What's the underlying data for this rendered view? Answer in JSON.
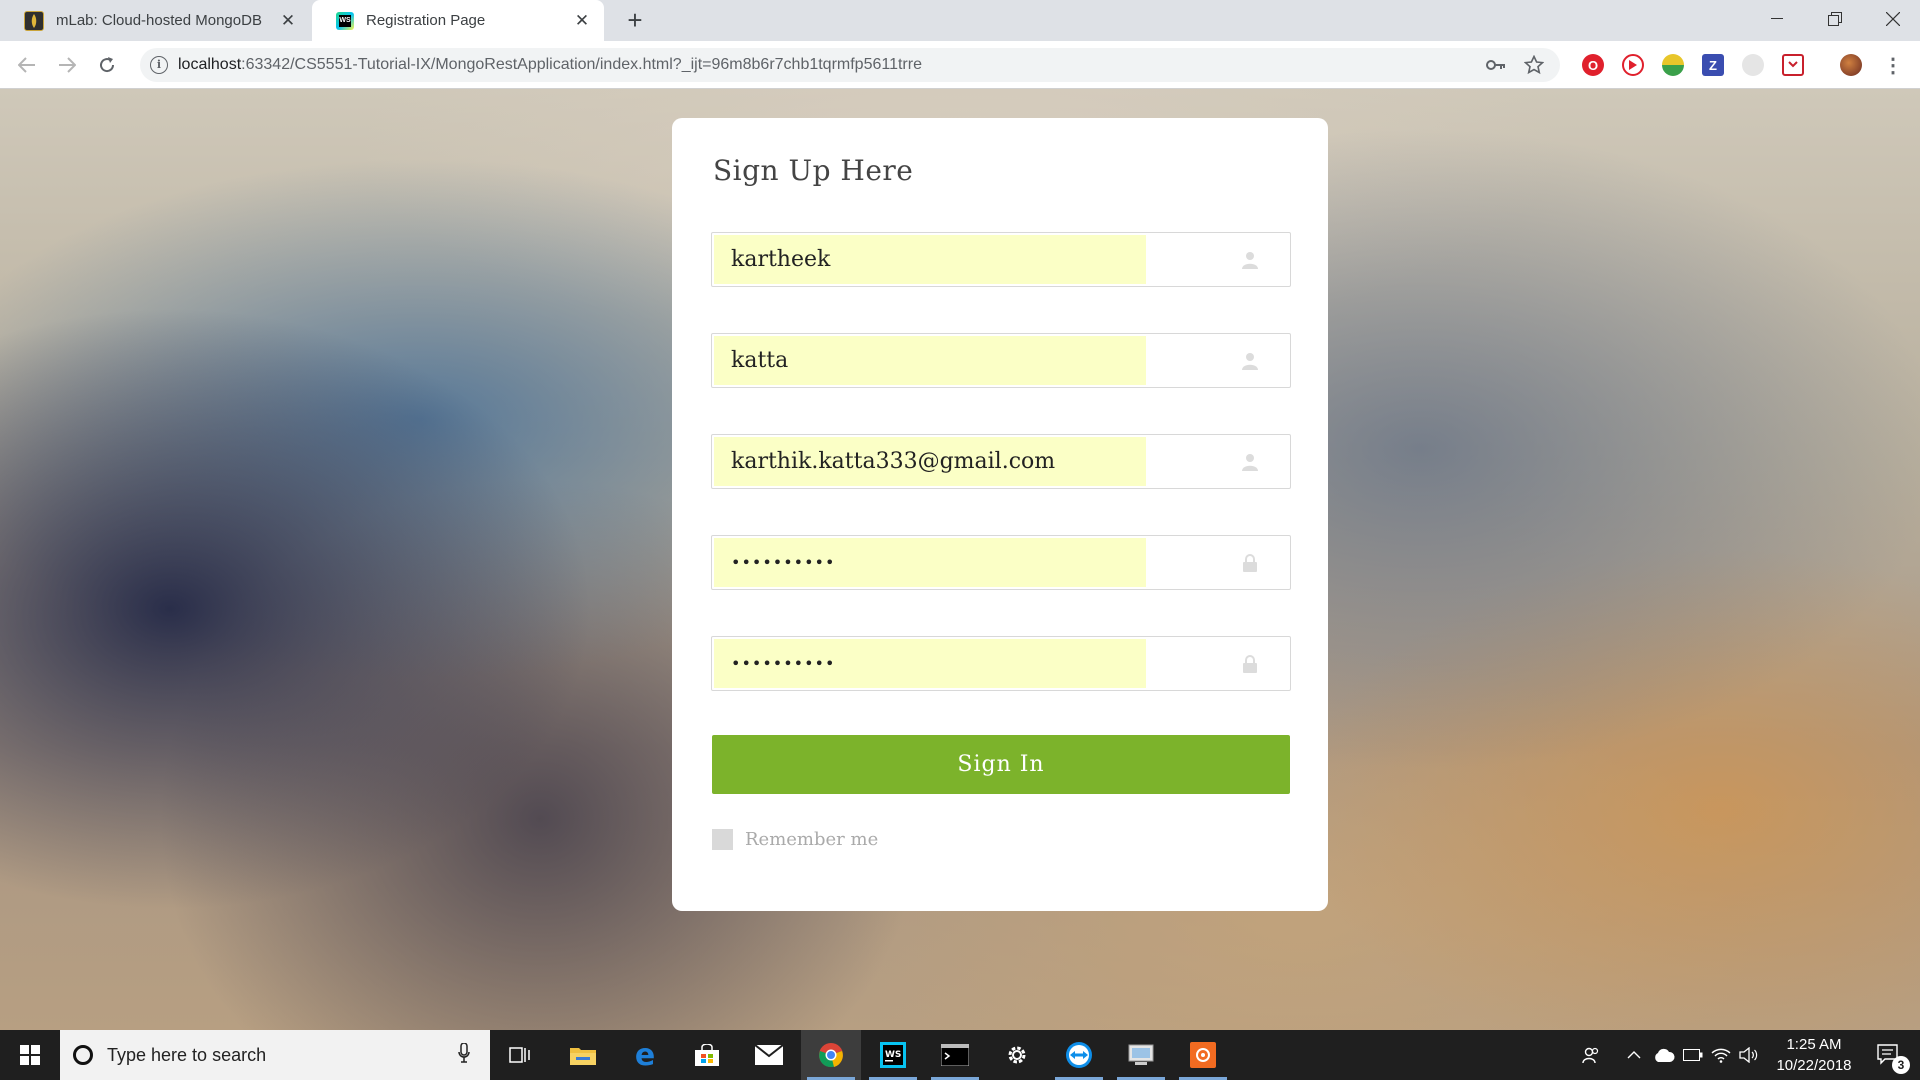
{
  "browser": {
    "tabs": [
      {
        "title": "mLab: Cloud-hosted MongoDB",
        "active": false,
        "icon": "mlab-favicon"
      },
      {
        "title": "Registration Page",
        "active": true,
        "icon": "webstorm-favicon"
      }
    ],
    "url_host": "localhost",
    "url_rest": ":63342/CS5551-Tutorial-IX/MongoRestApplication/index.html?_ijt=96m8b6r7chb1tqrmfp5611trre"
  },
  "form": {
    "title": "Sign Up Here",
    "fields": [
      {
        "name": "first-name",
        "value": "kartheek",
        "type": "text",
        "icon": "user-icon"
      },
      {
        "name": "last-name",
        "value": "katta",
        "type": "text",
        "icon": "user-icon"
      },
      {
        "name": "email",
        "value": "karthik.katta333@gmail.com",
        "type": "text",
        "icon": "user-icon"
      },
      {
        "name": "password",
        "value": "••••••••••",
        "type": "password",
        "icon": "lock-icon"
      },
      {
        "name": "confirm-password",
        "value": "••••••••••",
        "type": "password",
        "icon": "lock-icon"
      }
    ],
    "submit_label": "Sign In",
    "remember_label": "Remember me",
    "accent_color": "#7cb32b",
    "autofill_color": "#fbffc6"
  },
  "taskbar": {
    "search_placeholder": "Type here to search",
    "time": "1:25 AM",
    "date": "10/22/2018",
    "notification_count": "3"
  }
}
